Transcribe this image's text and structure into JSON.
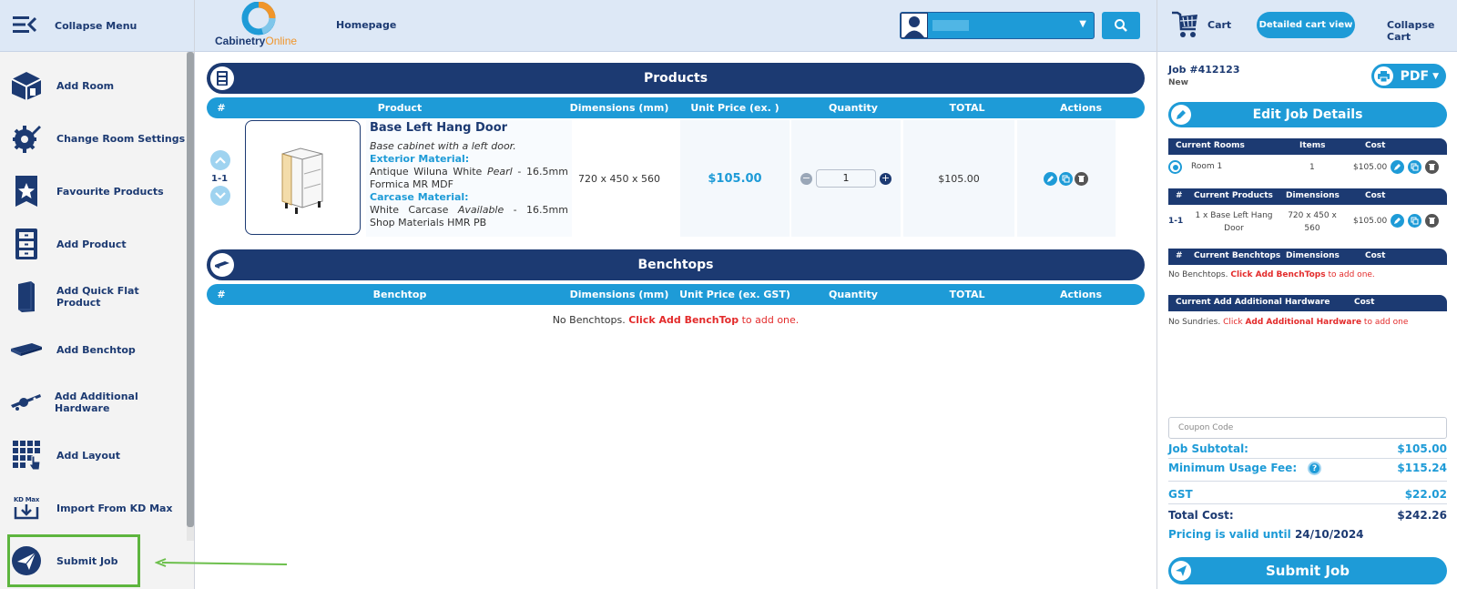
{
  "sidebar": {
    "collapse_label": "Collapse Menu",
    "items": [
      {
        "label": "Add Room",
        "icon": "room-box-icon"
      },
      {
        "label": "Change Room Settings",
        "icon": "gear-pencil-icon"
      },
      {
        "label": "Favourite Products",
        "icon": "bookmark-star-icon"
      },
      {
        "label": "Add Product",
        "icon": "cabinet-icon"
      },
      {
        "label": "Add Quick Flat Product",
        "icon": "panel-icon"
      },
      {
        "label": "Add Benchtop",
        "icon": "benchtop-icon"
      },
      {
        "label": "Add Additional Hardware",
        "icon": "hinge-icon"
      },
      {
        "label": "Add Layout",
        "icon": "grid-hand-icon"
      },
      {
        "label": "Import From KD Max",
        "icon": "kdmax-import-icon",
        "icon_text": "KD Max"
      },
      {
        "label": "Submit Job",
        "icon": "paper-plane-icon"
      }
    ]
  },
  "header": {
    "logo_text_1": "Cabinetry",
    "logo_text_2": "Online",
    "homepage_label": "Homepage"
  },
  "products": {
    "title": "Products",
    "columns": [
      "#",
      "Product",
      "Dimensions (mm)",
      "Unit Price (ex. )",
      "Quantity",
      "TOTAL",
      "Actions"
    ],
    "rows": [
      {
        "num": "1-1",
        "name": "Base Left Hang Door",
        "description": "Base cabinet with a left door.",
        "exterior_label": "Exterior Material:",
        "exterior_value": [
          "Antique",
          "Wiluna",
          "White",
          "Pearl",
          "-",
          "16.5mm"
        ],
        "exterior_value_2": "Formica MR MDF",
        "carcase_label": "Carcase Material:",
        "carcase_value": [
          "White",
          "Carcase",
          "Available",
          "-",
          "16.5mm"
        ],
        "carcase_value_2": "Shop Materials HMR PB",
        "dimensions": "720 x 450 x 560",
        "unit_price": "$105.00",
        "quantity": "1",
        "total": "$105.00"
      }
    ]
  },
  "benchtops": {
    "title": "Benchtops",
    "columns": [
      "#",
      "Benchtop",
      "Dimensions (mm)",
      "Unit Price (ex. GST)",
      "Quantity",
      "TOTAL",
      "Actions"
    ],
    "empty_prefix": "No Benchtops.",
    "empty_link": "Click Add BenchTop",
    "empty_suffix": "to add one."
  },
  "cart": {
    "label": "Cart",
    "detailed_view_label": "Detailed cart view",
    "collapse_label": "Collapse Cart",
    "job_number": "Job #412123",
    "job_status": "New",
    "pdf_label": "PDF",
    "edit_job_label": "Edit Job Details",
    "rooms_head": [
      "Current Rooms",
      "Items",
      "Cost"
    ],
    "room": {
      "name": "Room 1",
      "items": "1",
      "cost": "$105.00"
    },
    "products_head": [
      "#",
      "Current Products",
      "Dimensions",
      "Cost"
    ],
    "product": {
      "num": "1-1",
      "name_1": "1 x Base Left Hang",
      "name_2": "Door",
      "dim_1": "720 x 450 x",
      "dim_2": "560",
      "cost": "$105.00"
    },
    "benchtops_head": [
      "#",
      "Current Benchtops",
      "Dimensions",
      "Cost"
    ],
    "benchtops_empty_prefix": "No Benchtops.",
    "benchtops_empty_link": "Click Add BenchTops",
    "benchtops_empty_suffix": "to add one.",
    "hardware_head": [
      "Current Add Additional Hardware",
      "Cost"
    ],
    "hardware_empty_prefix": "No Sundries.",
    "hardware_empty_click": "Click",
    "hardware_empty_link": "Add Additional Hardware",
    "hardware_empty_suffix": "to add one",
    "coupon_placeholder": "Coupon Code",
    "subtotal_label": "Job Subtotal:",
    "subtotal_value": "$105.00",
    "min_fee_label": "Minimum Usage Fee:",
    "min_fee_value": "$115.24",
    "gst_label": "GST",
    "gst_value": "$22.02",
    "total_label": "Total Cost:",
    "total_value": "$242.26",
    "pricing_valid_label": "Pricing is valid until",
    "pricing_valid_date": "24/10/2024",
    "submit_label": "Submit Job"
  },
  "colors": {
    "navy": "#1c3a72",
    "blue": "#1e9bd7",
    "red_link": "#e32b2b",
    "highlight_green": "#5db53e"
  }
}
